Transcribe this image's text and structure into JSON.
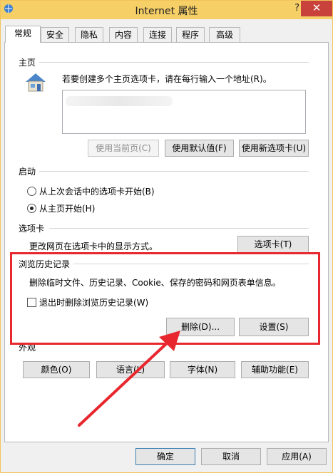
{
  "window": {
    "title": "Internet 属性",
    "help": "?",
    "close": "✕"
  },
  "tabs": [
    "常规",
    "安全",
    "隐私",
    "内容",
    "连接",
    "程序",
    "高级"
  ],
  "home": {
    "label": "主页",
    "instruction": "若要创建多个主页选项卡，请在每行输入一个地址(R)。",
    "buttons": {
      "current": "使用当前页(C)",
      "default": "使用默认值(F)",
      "newtab": "使用新选项卡(U)"
    }
  },
  "startup": {
    "label": "启动",
    "option1": "从上次会话中的选项卡开始(B)",
    "option2": "从主页开始(H)",
    "selected": "option2"
  },
  "tabs_section": {
    "label": "选项卡",
    "description": "更改网页在选项卡中的显示方式。",
    "button": "选项卡(T)"
  },
  "history": {
    "label": "浏览历史记录",
    "description": "删除临时文件、历史记录、Cookie、保存的密码和网页表单信息。",
    "checkbox": "退出时删除浏览历史记录(W)",
    "checked": false,
    "delete_button": "删除(D)...",
    "settings_button": "设置(S)"
  },
  "appearance": {
    "label": "外观",
    "buttons": [
      "颜色(O)",
      "语言(L)",
      "字体(N)",
      "辅助功能(E)"
    ]
  },
  "footer": {
    "ok": "确定",
    "cancel": "取消",
    "apply": "应用(A)"
  },
  "colors": {
    "titlebar": "#f6cf67",
    "close": "#c8413a",
    "annotation": "#e8262d"
  }
}
